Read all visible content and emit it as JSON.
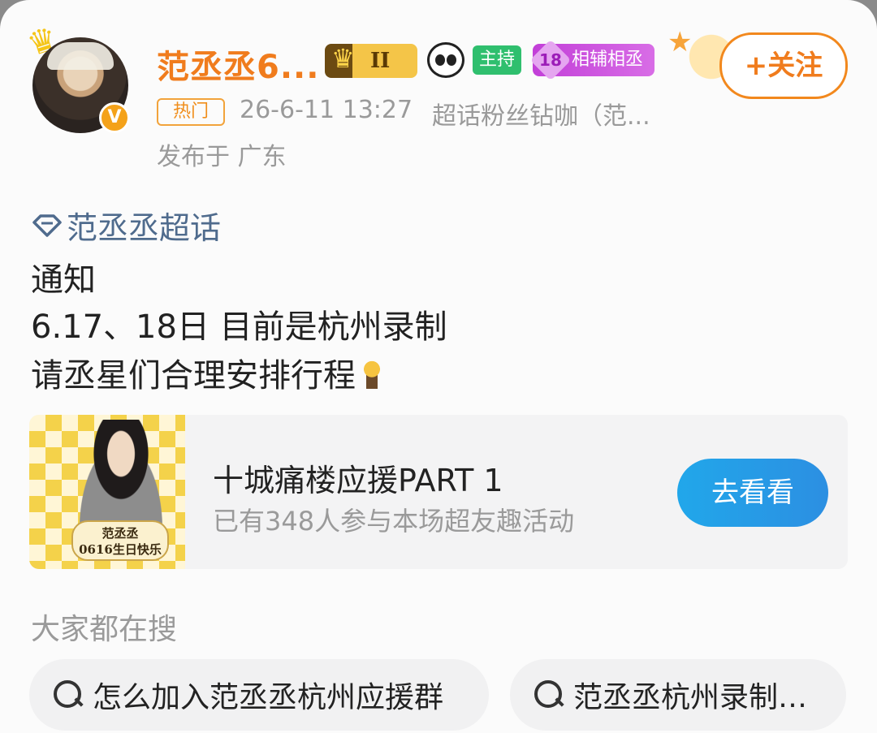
{
  "post": {
    "username": "范丞丞6...",
    "rank_badge": "II",
    "host_badge": "主持",
    "fan_badge": {
      "level": "18",
      "label": "相辅相丞"
    },
    "follow_label": "+关注",
    "hot_tag": "热门",
    "time": "26-6-11 13:27",
    "source": "超话粉丝钻咖（范...",
    "location": "发布于 广东",
    "topic": "范丞丞超话",
    "lines": [
      "通知",
      "6.17、18日 目前是杭州录制",
      "请丞星们合理安排行程"
    ],
    "icons": {
      "avatar_badge": "verified-v-icon",
      "topic": "diamond-icon",
      "emoji": "lightbulb-person-emoji"
    }
  },
  "event": {
    "title": "十城痛楼应援PART 1",
    "subtitle": "已有348人参与本场超友趣活动",
    "button": "去看看",
    "thumb_caption_line1": "范丞丞",
    "thumb_caption_line2": "0616生日快乐"
  },
  "search": {
    "title": "大家都在搜",
    "chips": [
      "怎么加入范丞丞杭州应援群",
      "范丞丞杭州录制…"
    ]
  },
  "colors": {
    "accent_orange": "#f07c1d",
    "topic_blue": "#4f6b8d",
    "button_blue": "#21a7ea",
    "host_green": "#2fbf6e",
    "fan_purple": "#c23fd8"
  }
}
